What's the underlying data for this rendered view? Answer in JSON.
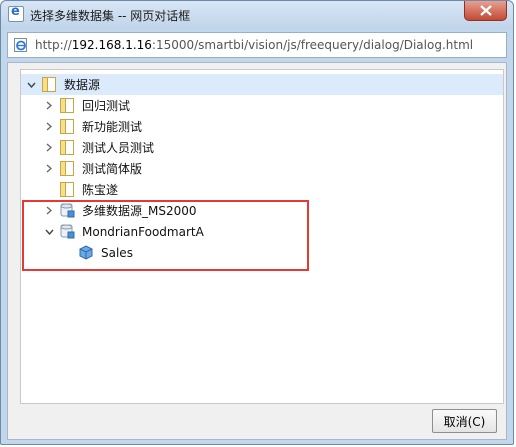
{
  "window": {
    "title": "选择多维数据集 -- 网页对话框",
    "close_label": "close"
  },
  "address": {
    "url_prefix": "http://",
    "host": "192.168.1.16",
    "rest": ":15000/smartbi/vision/js/freequery/dialog/Dialog.html"
  },
  "tree": {
    "root": {
      "label": "数据源",
      "expanded": true,
      "selected": true
    },
    "folders": [
      {
        "label": "回归测试",
        "expanded": false
      },
      {
        "label": "新功能测试",
        "expanded": false
      },
      {
        "label": "测试人员测试",
        "expanded": false
      },
      {
        "label": "测试简体版",
        "expanded": false
      },
      {
        "label": "陈宝遂",
        "expanded": false,
        "leaf": true
      }
    ],
    "datasources": [
      {
        "label": "多维数据源_MS2000",
        "expanded": false
      },
      {
        "label": "MondrianFoodmartA",
        "expanded": true,
        "cubes": [
          {
            "label": "Sales"
          }
        ]
      }
    ]
  },
  "buttons": {
    "cancel": "取消(C)"
  },
  "colors": {
    "highlight_border": "#e53935",
    "selected_row": "#dcebfc",
    "folder_fill": "#f6df8a",
    "cube_fill": "#4a90d9"
  },
  "icons": {
    "folder": "folder-icon",
    "datasource": "database-icon",
    "cube": "cube-icon",
    "expand": "chevron-right-icon",
    "collapse": "chevron-down-icon",
    "page": "ie-page-icon"
  }
}
